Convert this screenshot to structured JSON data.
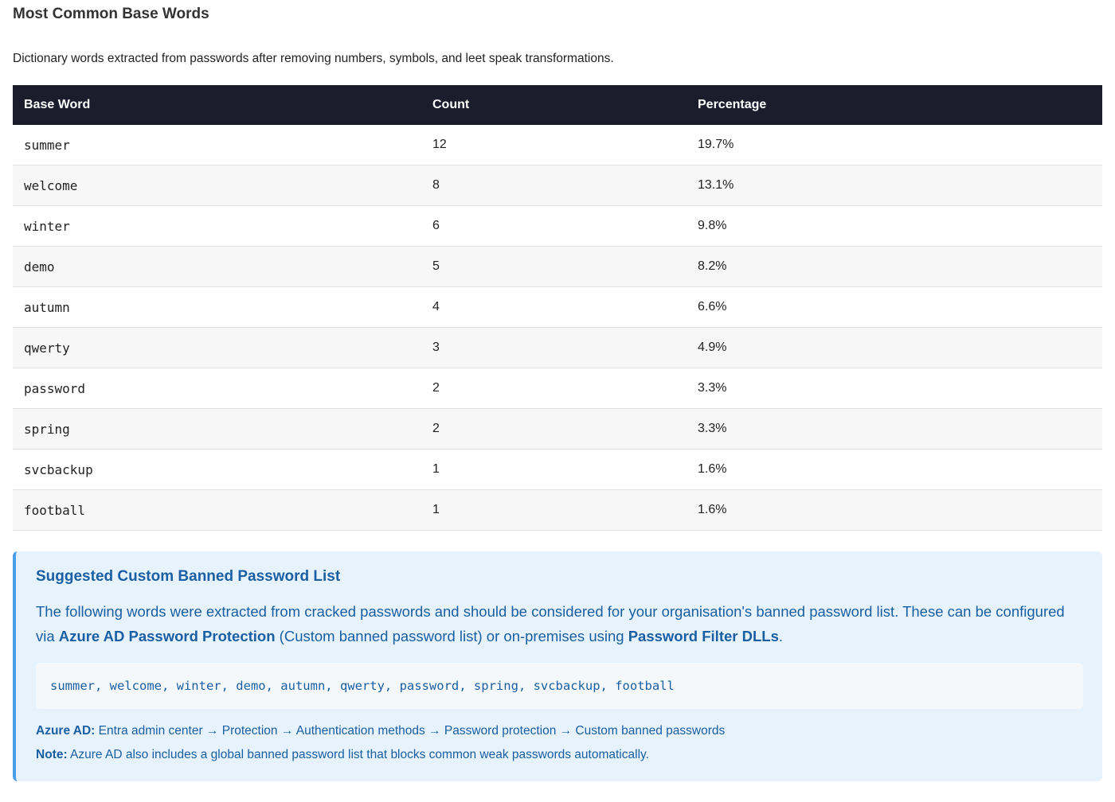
{
  "section": {
    "title": "Most Common Base Words",
    "description": "Dictionary words extracted from passwords after removing numbers, symbols, and leet speak transformations."
  },
  "table": {
    "headers": [
      "Base Word",
      "Count",
      "Percentage"
    ],
    "rows": [
      {
        "word": "summer",
        "count": "12",
        "percentage": "19.7%"
      },
      {
        "word": "welcome",
        "count": "8",
        "percentage": "13.1%"
      },
      {
        "word": "winter",
        "count": "6",
        "percentage": "9.8%"
      },
      {
        "word": "demo",
        "count": "5",
        "percentage": "8.2%"
      },
      {
        "word": "autumn",
        "count": "4",
        "percentage": "6.6%"
      },
      {
        "word": "qwerty",
        "count": "3",
        "percentage": "4.9%"
      },
      {
        "word": "password",
        "count": "2",
        "percentage": "3.3%"
      },
      {
        "word": "spring",
        "count": "2",
        "percentage": "3.3%"
      },
      {
        "word": "svcbackup",
        "count": "1",
        "percentage": "1.6%"
      },
      {
        "word": "football",
        "count": "1",
        "percentage": "1.6%"
      }
    ]
  },
  "callout": {
    "title": "Suggested Custom Banned Password List",
    "body_part1": "The following words were extracted from cracked passwords and should be considered for your organisation's banned password list. These can be configured via ",
    "body_strong1": "Azure AD Password Protection",
    "body_part2": " (Custom banned password list) or on-premises using ",
    "body_strong2": "Password Filter DLLs",
    "body_part3": ".",
    "word_list": "summer, welcome, winter, demo, autumn, qwerty, password, spring, svcbackup, football",
    "azure_label": "Azure AD:",
    "azure_path": " Entra admin center → Protection → Authentication methods → Password protection → Custom banned passwords",
    "note_label": "Note:",
    "note_text": " Azure AD also includes a global banned password list that blocks common weak passwords automatically."
  },
  "colors": {
    "header_bg": "#1b1c2c",
    "callout_bg": "#e6f2fc",
    "callout_accent": "#4a9ee8",
    "callout_text": "#1a5fa3"
  }
}
